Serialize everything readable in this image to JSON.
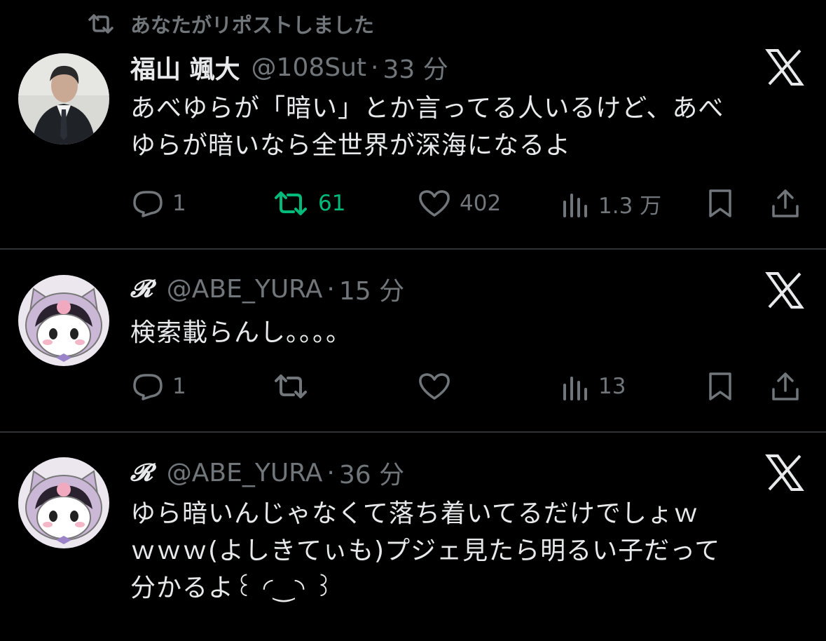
{
  "repost_banner": {
    "text": "あなたがリポストしました",
    "icon": "repost-icon"
  },
  "colors": {
    "background": "#000000",
    "text": "#e7e9ea",
    "muted": "#71767b",
    "divider": "#2f3336",
    "repost_active": "#00ba7c"
  },
  "tweets": [
    {
      "name": "福山 颯大",
      "handle": "@108Sut",
      "separator": "·",
      "time": "33 分",
      "body": [
        "あべゆらが「暗い」とか言ってる人いるけど、あべ",
        "ゆらが暗いなら全世界が深海になるよ"
      ],
      "actions": {
        "reply": "1",
        "repost": "61",
        "like": "402",
        "views": "1.3 万"
      },
      "reposted": true
    },
    {
      "name": "𝓡",
      "handle": "@ABE_YURA",
      "separator": "·",
      "time": "15 分",
      "body": [
        "検索載らんし。。。。"
      ],
      "actions": {
        "reply": "1",
        "repost": "",
        "like": "",
        "views": "13"
      },
      "reposted": false
    },
    {
      "name": "𝓡",
      "handle": "@ABE_YURA",
      "separator": "·",
      "time": "36 分",
      "body": [
        "ゆら暗いんじゃなくて落ち着いてるだけでしょｗ",
        "ｗｗｗ(よしきてぃも)プジェ見たら明るい子だって",
        "分かるよ꒰ ◜‿◝ ꒱"
      ],
      "actions": null,
      "reposted": false
    }
  ]
}
